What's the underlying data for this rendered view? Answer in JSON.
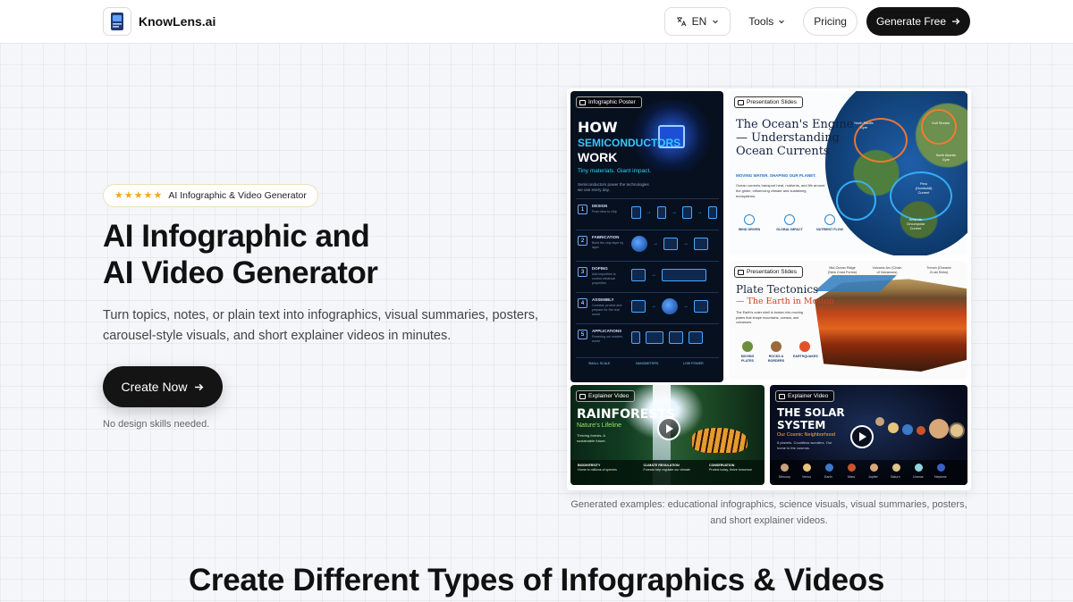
{
  "header": {
    "brand": "KnowLens.ai",
    "language": "EN",
    "tools": "Tools",
    "pricing": "Pricing",
    "generate": "Generate Free"
  },
  "hero": {
    "rating_stars": 5,
    "badge": "AI Infographic & Video Generator",
    "title_line1": "AI Infographic and",
    "title_line2": "AI Video Generator",
    "subtitle": "Turn topics, notes, or plain text into infographics, visual summaries, posters, carousel-style visuals, and short explainer videos in minutes.",
    "cta": "Create Now",
    "note": "No design skills needed."
  },
  "gallery": {
    "caption": "Generated examples: educational infographics, science visuals, visual summaries, posters, and short explainer videos.",
    "cards": {
      "semiconductors": {
        "tag": "Infographic Poster",
        "title_a": "HOW",
        "title_b": "SEMICONDUCTORS",
        "title_c": "WORK",
        "tagline": "Tiny materials. Giant impact.",
        "intro": "Semiconductors power the technologies we use every day.",
        "steps": [
          {
            "num": "1",
            "label": "DESIGN",
            "desc": "From idea to chip"
          },
          {
            "num": "2",
            "label": "FABRICATION",
            "desc": "Build the chip layer by layer"
          },
          {
            "num": "3",
            "label": "DOPING",
            "desc": "Add impurities to control electrical properties"
          },
          {
            "num": "4",
            "label": "ASSEMBLY",
            "desc": "Connect, protect and prepare for the real world"
          },
          {
            "num": "5",
            "label": "APPLICATIONS",
            "desc": "Powering our modern world"
          }
        ],
        "footer": [
          "SMALL SCALE",
          "NANOMETERS",
          "LOW POWER"
        ]
      },
      "ocean": {
        "tag": "Presentation Slides",
        "title": "The Ocean's Engine — Understanding Ocean Currents",
        "subhead": "MOVING WATER. SHAPING OUR PLANET.",
        "body": "Ocean currents transport heat, nutrients, and life around the globe, influencing climate and sustaining ecosystems.",
        "icons": [
          "WIND DRIVEN",
          "GLOBAL IMPACT",
          "NUTRIENT FLOW"
        ],
        "labels": [
          "North Pacific Gyre",
          "Gulf Stream",
          "North Atlantic Gyre",
          "Peru (Humboldt) Current",
          "Antarctic Circumpolar Current"
        ]
      },
      "plates": {
        "tag": "Presentation Slides",
        "title": "Plate Tectonics",
        "subtitle": "— The Earth in Motion",
        "body": "The Earth's outer shell is broken into moving plates that shape mountains, oceans, and volcanoes.",
        "labels": [
          "Mid-Ocean Ridge (New Crust Forms)",
          "Volcanic Arc (Chain of Volcanoes)",
          "Trench (Oceanic Crust Sinks)"
        ],
        "icons": [
          "MOVING PLATES",
          "ROCKS & BORDERS",
          "EARTHQUAKES"
        ]
      },
      "rainforest": {
        "tag": "Explainer Video",
        "title": "RAINFORESTS",
        "subtitle": "Nature's Lifeline",
        "body": "Thriving forests. A sustainable future.",
        "bar": [
          {
            "title": "BIODIVERSITY",
            "desc": "Home to millions of species"
          },
          {
            "title": "CLIMATE REGULATION",
            "desc": "Forests help regulate our climate"
          },
          {
            "title": "CONSERVATION",
            "desc": "Protect today, thrive tomorrow"
          }
        ]
      },
      "solar": {
        "tag": "Explainer Video",
        "title_a": "THE SOLAR",
        "title_b": "SYSTEM",
        "subtitle": "Our Cosmic Neighborhood",
        "body": "8 planets. Countless wonders. Our home in the cosmos.",
        "planets": [
          "Mercury",
          "Venus",
          "Earth",
          "Mars",
          "Jupiter",
          "Saturn",
          "Uranus",
          "Neptune"
        ]
      }
    }
  },
  "section": {
    "title": "Create Different Types of Infographics & Videos"
  },
  "colors": {
    "primary_dark": "#121212",
    "star": "#f5a623",
    "accent_blue": "#38c6ff"
  }
}
